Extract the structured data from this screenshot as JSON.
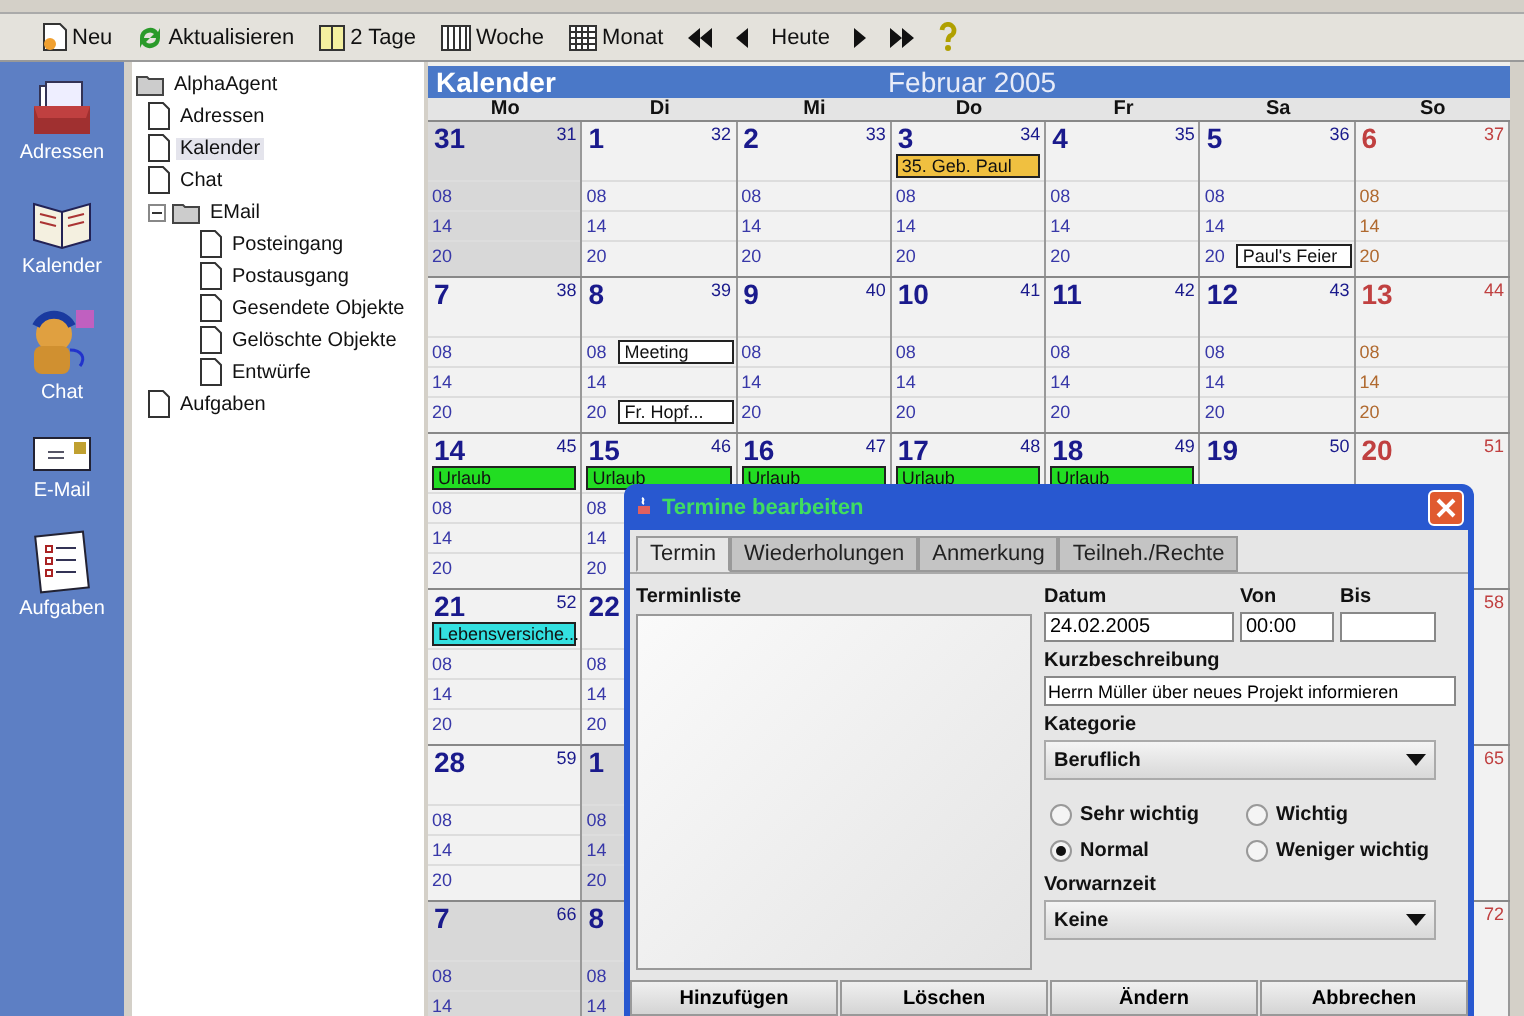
{
  "toolbar": [
    {
      "kind": "text",
      "label": "Neu"
    },
    {
      "kind": "text",
      "label": "Aktualisieren"
    },
    {
      "kind": "text",
      "label": "2 Tage"
    },
    {
      "kind": "text",
      "label": "Woche"
    },
    {
      "kind": "text",
      "label": "Monat"
    },
    {
      "kind": "icon"
    },
    {
      "kind": "icon"
    },
    {
      "kind": "text",
      "label": "Heute"
    },
    {
      "kind": "icon"
    },
    {
      "kind": "icon"
    },
    {
      "kind": "icon"
    }
  ],
  "sidebar": {
    "items": [
      {
        "label": "Adressen"
      },
      {
        "label": "Kalender"
      },
      {
        "label": "Chat"
      },
      {
        "label": "E-Mail"
      },
      {
        "label": "Aufgaben"
      }
    ]
  },
  "tree": {
    "label": "AlphaAgent",
    "children": [
      {
        "label": "Adressen",
        "selected": false
      },
      {
        "label": "Kalender",
        "selected": true
      },
      {
        "label": "Chat",
        "selected": false
      },
      {
        "label": "EMail",
        "selected": false,
        "expanded": true,
        "children": [
          {
            "label": "Posteingang",
            "selected": false
          },
          {
            "label": "Postausgang",
            "selected": false
          },
          {
            "label": "Gesendete Objekte",
            "selected": false
          },
          {
            "label": "Gelöschte Objekte",
            "selected": false
          },
          {
            "label": "Entwürfe",
            "selected": false
          }
        ]
      },
      {
        "label": "Aufgaben",
        "selected": false
      }
    ]
  },
  "calendar": {
    "title": "Kalender",
    "month": "Februar 2005",
    "days": [
      {
        "label": "Mo",
        "sunday": false
      },
      {
        "label": "Di",
        "sunday": false
      },
      {
        "label": "Mi",
        "sunday": false
      },
      {
        "label": "Do",
        "sunday": false
      },
      {
        "label": "Fr",
        "sunday": false
      },
      {
        "label": "Sa",
        "sunday": false
      },
      {
        "label": "So",
        "sunday": true
      }
    ],
    "weeks": [
      {
        "cells": [
          {
            "date": "31",
            "corner": "31",
            "outside": true,
            "hours": [
              {
                "label": "08"
              },
              {
                "label": "14"
              },
              {
                "label": "20"
              }
            ]
          },
          {
            "date": "1",
            "corner": "32",
            "outside": false,
            "hours": [
              {
                "label": "08"
              },
              {
                "label": "14"
              },
              {
                "label": "20"
              }
            ]
          },
          {
            "date": "2",
            "corner": "33",
            "outside": false,
            "hours": [
              {
                "label": "08"
              },
              {
                "label": "14"
              },
              {
                "label": "20"
              }
            ]
          },
          {
            "date": "3",
            "corner": "34",
            "outside": false,
            "allday": [
              {
                "text": "35. Geb. Paul",
                "color": "#f0c040"
              }
            ],
            "hours": [
              {
                "label": "08"
              },
              {
                "label": "14"
              },
              {
                "label": "20"
              }
            ]
          },
          {
            "date": "4",
            "corner": "35",
            "outside": false,
            "hours": [
              {
                "label": "08"
              },
              {
                "label": "14"
              },
              {
                "label": "20"
              }
            ]
          },
          {
            "date": "5",
            "corner": "36",
            "outside": false,
            "hours": [
              {
                "label": "08"
              },
              {
                "label": "14"
              },
              {
                "label": "20",
                "events": [
                  {
                    "text": "Paul's Feier",
                    "color": "#ffffff"
                  }
                ]
              }
            ]
          },
          {
            "date": "6",
            "corner": "37",
            "outside": false,
            "hours": [
              {
                "label": "08"
              },
              {
                "label": "14"
              },
              {
                "label": "20"
              }
            ]
          }
        ]
      },
      {
        "cells": [
          {
            "date": "7",
            "corner": "38",
            "outside": false,
            "hours": [
              {
                "label": "08"
              },
              {
                "label": "14"
              },
              {
                "label": "20"
              }
            ]
          },
          {
            "date": "8",
            "corner": "39",
            "outside": false,
            "hours": [
              {
                "label": "08",
                "events": [
                  {
                    "text": "Meeting",
                    "color": "#ffffff"
                  }
                ]
              },
              {
                "label": "14"
              },
              {
                "label": "20",
                "events": [
                  {
                    "text": "Fr. Hopf...",
                    "color": "#ffffff"
                  }
                ]
              }
            ]
          },
          {
            "date": "9",
            "corner": "40",
            "outside": false,
            "hours": [
              {
                "label": "08"
              },
              {
                "label": "14"
              },
              {
                "label": "20"
              }
            ]
          },
          {
            "date": "10",
            "corner": "41",
            "outside": false,
            "hours": [
              {
                "label": "08"
              },
              {
                "label": "14"
              },
              {
                "label": "20"
              }
            ]
          },
          {
            "date": "11",
            "corner": "42",
            "outside": false,
            "hours": [
              {
                "label": "08"
              },
              {
                "label": "14"
              },
              {
                "label": "20"
              }
            ]
          },
          {
            "date": "12",
            "corner": "43",
            "outside": false,
            "hours": [
              {
                "label": "08"
              },
              {
                "label": "14"
              },
              {
                "label": "20"
              }
            ]
          },
          {
            "date": "13",
            "corner": "44",
            "outside": false,
            "hours": [
              {
                "label": "08"
              },
              {
                "label": "14"
              },
              {
                "label": "20"
              }
            ]
          }
        ]
      },
      {
        "cells": [
          {
            "date": "14",
            "corner": "45",
            "outside": false,
            "allday": [
              {
                "text": "Urlaub",
                "color": "#22dd22"
              }
            ],
            "hours": [
              {
                "label": "08"
              },
              {
                "label": "14"
              },
              {
                "label": "20"
              }
            ]
          },
          {
            "date": "15",
            "corner": "46",
            "outside": false,
            "allday": [
              {
                "text": "Urlaub",
                "color": "#22dd22"
              }
            ],
            "hours": [
              {
                "label": "08"
              },
              {
                "label": "14"
              },
              {
                "label": "20"
              }
            ]
          },
          {
            "date": "16",
            "corner": "47",
            "outside": false,
            "allday": [
              {
                "text": "Urlaub",
                "color": "#22dd22"
              }
            ]
          },
          {
            "date": "17",
            "corner": "48",
            "outside": false,
            "allday": [
              {
                "text": "Urlaub",
                "color": "#22dd22"
              }
            ]
          },
          {
            "date": "18",
            "corner": "49",
            "outside": false,
            "allday": [
              {
                "text": "Urlaub",
                "color": "#22dd22"
              }
            ]
          },
          {
            "date": "19",
            "corner": "50",
            "outside": false
          },
          {
            "date": "20",
            "corner": "51",
            "outside": false
          }
        ]
      },
      {
        "cells": [
          {
            "date": "21",
            "corner": "52",
            "outside": false,
            "allday": [
              {
                "text": "Lebensversiche...",
                "color": "#33e0e0"
              }
            ],
            "hours": [
              {
                "label": "08"
              },
              {
                "label": "14"
              },
              {
                "label": "20"
              }
            ]
          },
          {
            "date": "22",
            "outside": false,
            "hours": [
              {
                "label": "08"
              },
              {
                "label": "14"
              },
              {
                "label": "20"
              }
            ]
          },
          {},
          {},
          {},
          {},
          {
            "corner": "58"
          }
        ]
      },
      {
        "cells": [
          {
            "date": "28",
            "corner": "59",
            "outside": false,
            "hours": [
              {
                "label": "08"
              },
              {
                "label": "14"
              },
              {
                "label": "20"
              }
            ]
          },
          {
            "date": "1",
            "outside": true,
            "hours": [
              {
                "label": "08"
              },
              {
                "label": "14"
              },
              {
                "label": "20"
              }
            ]
          },
          {},
          {},
          {},
          {},
          {
            "corner": "65"
          }
        ]
      },
      {
        "cells": [
          {
            "date": "7",
            "corner": "66",
            "outside": true,
            "hours": [
              {
                "label": "08"
              },
              {
                "label": "14"
              }
            ]
          },
          {
            "date": "8",
            "outside": true,
            "hours": [
              {
                "label": "08"
              },
              {
                "label": "14"
              }
            ]
          },
          {},
          {},
          {},
          {},
          {
            "corner": "72"
          }
        ]
      }
    ]
  },
  "dialog": {
    "title": "Termine bearbeiten",
    "tabs": [
      {
        "label": "Termin",
        "selected": true
      },
      {
        "label": "Wiederholungen",
        "selected": false
      },
      {
        "label": "Anmerkung",
        "selected": false
      },
      {
        "label": "Teilneh./Rechte",
        "selected": false
      }
    ],
    "list_label": "Terminliste",
    "date": {
      "label": "Datum",
      "value": "24.02.2005"
    },
    "from": {
      "label": "Von",
      "value": "00:00"
    },
    "to": {
      "label": "Bis"
    },
    "summary": {
      "label": "Kurzbeschreibung",
      "value": "Herrn Müller über neues Projekt informieren"
    },
    "category": {
      "label": "Kategorie",
      "value": "Beruflich"
    },
    "priorities": [
      {
        "label": "Sehr wichtig",
        "selected": false
      },
      {
        "label": "Wichtig",
        "selected": false
      },
      {
        "label": "Normal",
        "selected": true
      },
      {
        "label": "Weniger wichtig",
        "selected": false
      }
    ],
    "reminder": {
      "label": "Vorwarnzeit",
      "value": "Keine"
    },
    "buttons": [
      "Hinzufügen",
      "Löschen",
      "Ändern",
      "Abbrechen"
    ]
  }
}
